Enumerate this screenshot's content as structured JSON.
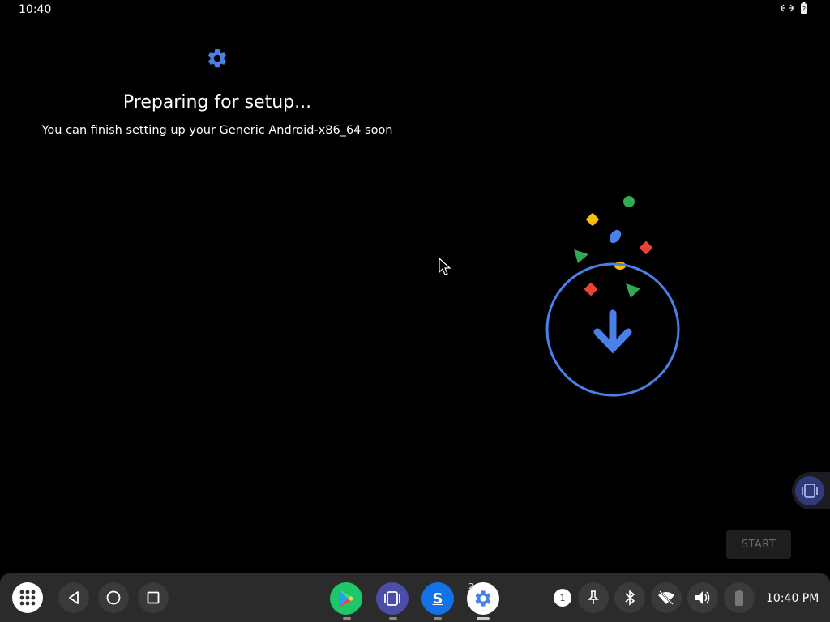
{
  "status_bar": {
    "time": "10:40",
    "icons": [
      "data-transfer-icon",
      "battery-unknown-icon"
    ]
  },
  "setup": {
    "icon": "gear-icon",
    "title": "Preparing for setup...",
    "subtitle": "You can finish setting up your Generic Android-x86_64 soon",
    "illustration": "download-confetti-illustration"
  },
  "start_button": {
    "label": "START"
  },
  "taskbar": {
    "nav": [
      "app-drawer-icon",
      "back-icon",
      "home-icon",
      "recents-icon"
    ],
    "apps": [
      {
        "name": "play-store-icon"
      },
      {
        "name": "screen-icon"
      },
      {
        "name": "skype-icon",
        "letter": "S"
      },
      {
        "name": "settings-icon",
        "badge": "2"
      }
    ],
    "notification_count": "1",
    "tray_icons": [
      "pin-icon",
      "bluetooth-icon",
      "wifi-off-icon",
      "volume-icon",
      "battery-icon"
    ],
    "clock": "10:40 PM"
  },
  "colors": {
    "accent_blue": "#4a80e8",
    "green": "#34a853",
    "yellow": "#fbbc05",
    "red": "#ea4335",
    "taskbar_bg": "#2b2b2b"
  }
}
